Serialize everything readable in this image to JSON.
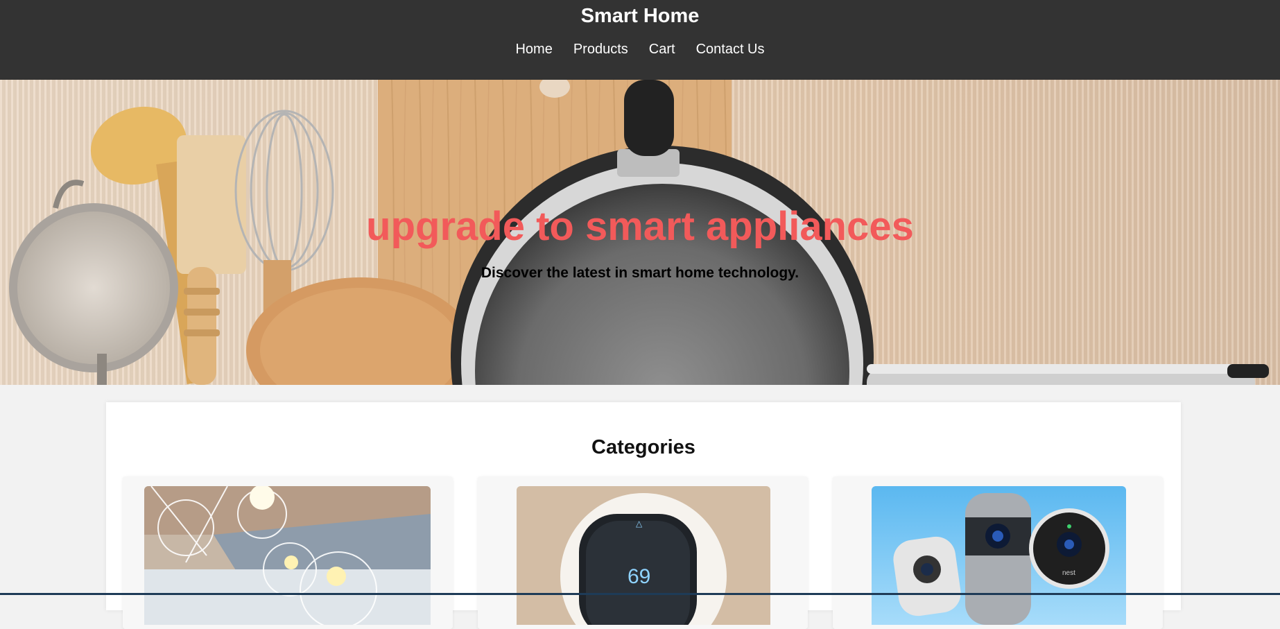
{
  "header": {
    "title": "Smart Home",
    "nav": [
      "Home",
      "Products",
      "Cart",
      "Contact Us"
    ]
  },
  "hero": {
    "heading": "upgrade to smart appliances",
    "subheading": "Discover the latest in smart home technology.",
    "heading_color": "#f25a5a"
  },
  "categories": {
    "title": "Categories",
    "cards": [
      {
        "image": "smart-lighting-image"
      },
      {
        "image": "smart-thermostat-image",
        "display_value": "69"
      },
      {
        "image": "security-cameras-image",
        "brand": "nest"
      }
    ]
  },
  "colors": {
    "header_bg": "#333333",
    "page_bg": "#f2f2f2"
  }
}
